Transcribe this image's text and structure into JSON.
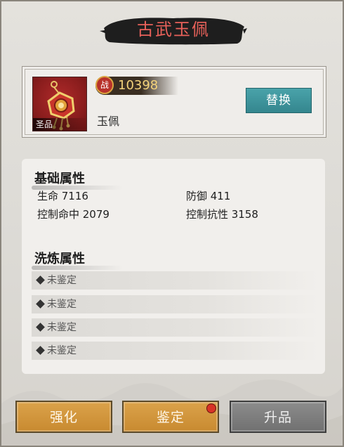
{
  "title": "古武玉佩",
  "item": {
    "rank": "圣品",
    "power": "10398",
    "power_icon_char": "战",
    "name": "玉佩",
    "replace_label": "替换"
  },
  "basic": {
    "title": "基础属性",
    "stats": [
      {
        "text": "生命  7116"
      },
      {
        "text": "防御  411"
      },
      {
        "text": "控制命中  2079"
      },
      {
        "text": "控制抗性  3158"
      }
    ]
  },
  "refine": {
    "title": "洗炼属性",
    "rows": [
      "未鉴定",
      "未鉴定",
      "未鉴定",
      "未鉴定"
    ]
  },
  "buttons": {
    "strengthen": "强化",
    "identify": "鉴定",
    "upgrade": "升品"
  },
  "icons": [
    "jade-pendant-icon",
    "battle-power-icon",
    "diamond-icon",
    "red-dot-badge"
  ],
  "colors": {
    "title_text": "#e8615a",
    "replace_button": "#3f959c",
    "gold_button": "#d29640",
    "gray_button": "#7e7e7e",
    "power_text": "#f3d27a"
  }
}
